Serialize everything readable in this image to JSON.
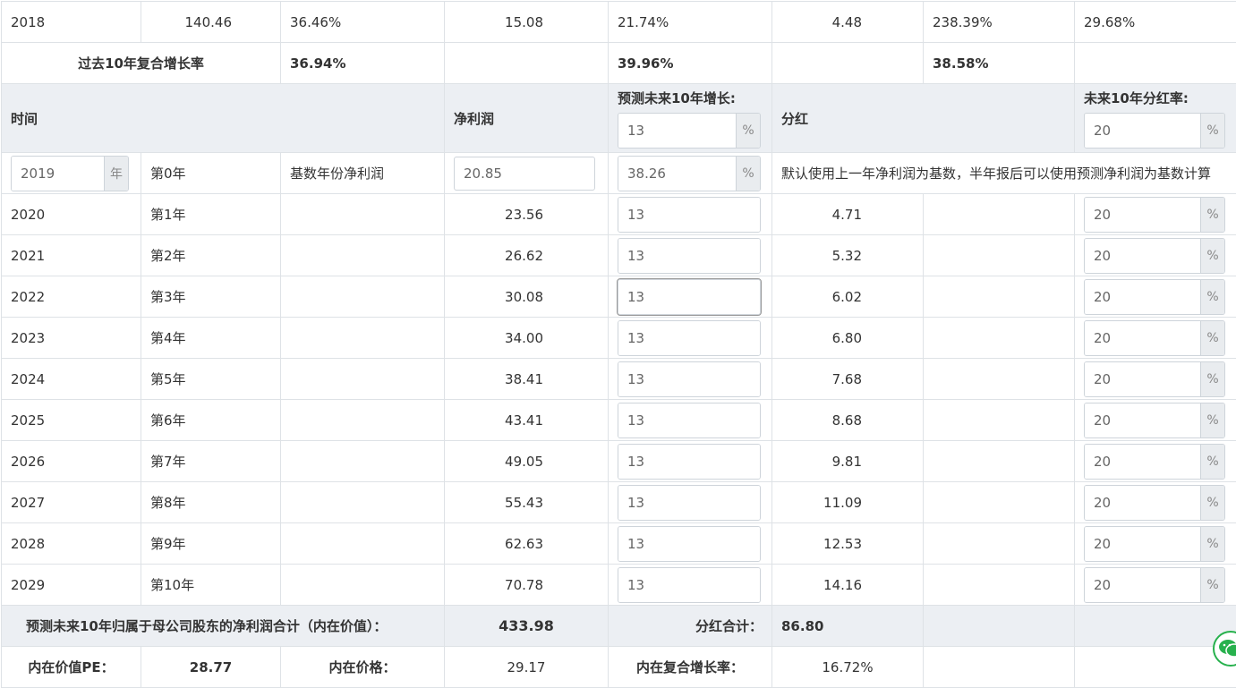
{
  "top_rows": [
    {
      "year": "2018",
      "c1": "140.46",
      "c2": "36.46%",
      "c3": "15.08",
      "c4": "21.74%",
      "c5": "4.48",
      "c6": "238.39%",
      "c7": "29.68%"
    }
  ],
  "cagr_row": {
    "label": "过去10年复合增长率",
    "v1": "36.94%",
    "v2": "39.96%",
    "v3": "38.58%"
  },
  "header": {
    "time_label": "时间",
    "net_profit_label": "净利润",
    "growth_label": "预测未来10年增长:",
    "growth_value": "13",
    "dividend_label": "分红",
    "payout_label": "未来10年分红率:",
    "payout_value": "20",
    "percent": "%"
  },
  "base_row": {
    "year_value": "2019",
    "year_unit": "年",
    "period": "第0年",
    "label": "基数年份净利润",
    "net_profit": "20.85",
    "growth": "38.26",
    "percent": "%",
    "note": "默认使用上一年净利润为基数，半年报后可以使用预测净利润为基数计算"
  },
  "forecast_rows": [
    {
      "year": "2020",
      "period": "第1年",
      "profit": "23.56",
      "growth": "13",
      "dividend": "4.71",
      "payout": "20"
    },
    {
      "year": "2021",
      "period": "第2年",
      "profit": "26.62",
      "growth": "13",
      "dividend": "5.32",
      "payout": "20"
    },
    {
      "year": "2022",
      "period": "第3年",
      "profit": "30.08",
      "growth": "13",
      "dividend": "6.02",
      "payout": "20"
    },
    {
      "year": "2023",
      "period": "第4年",
      "profit": "34.00",
      "growth": "13",
      "dividend": "6.80",
      "payout": "20"
    },
    {
      "year": "2024",
      "period": "第5年",
      "profit": "38.41",
      "growth": "13",
      "dividend": "7.68",
      "payout": "20"
    },
    {
      "year": "2025",
      "period": "第6年",
      "profit": "43.41",
      "growth": "13",
      "dividend": "8.68",
      "payout": "20"
    },
    {
      "year": "2026",
      "period": "第7年",
      "profit": "49.05",
      "growth": "13",
      "dividend": "9.81",
      "payout": "20"
    },
    {
      "year": "2027",
      "period": "第8年",
      "profit": "55.43",
      "growth": "13",
      "dividend": "11.09",
      "payout": "20"
    },
    {
      "year": "2028",
      "period": "第9年",
      "profit": "62.63",
      "growth": "13",
      "dividend": "12.53",
      "payout": "20"
    },
    {
      "year": "2029",
      "period": "第10年",
      "profit": "70.78",
      "growth": "13",
      "dividend": "14.16",
      "payout": "20"
    }
  ],
  "summary": {
    "total_label": "预测未来10年归属于母公司股东的净利润合计（内在价值）：",
    "total_value": "433.98",
    "dividend_total_label": "分红合计：",
    "dividend_total_value": "86.80"
  },
  "valuation": {
    "pe_label": "内在价值PE：",
    "pe_value": "28.77",
    "price_label": "内在价格：",
    "price_value": "29.17",
    "cagr_label": "内在复合增长率：",
    "cagr_value": "16.72%"
  },
  "icons": {
    "chat": "wechat-icon",
    "spinner": "number-spinner-icon"
  },
  "colors": {
    "header_bg": "#eceff3",
    "border": "#dee2e6",
    "wechat_green": "#27b14d"
  }
}
